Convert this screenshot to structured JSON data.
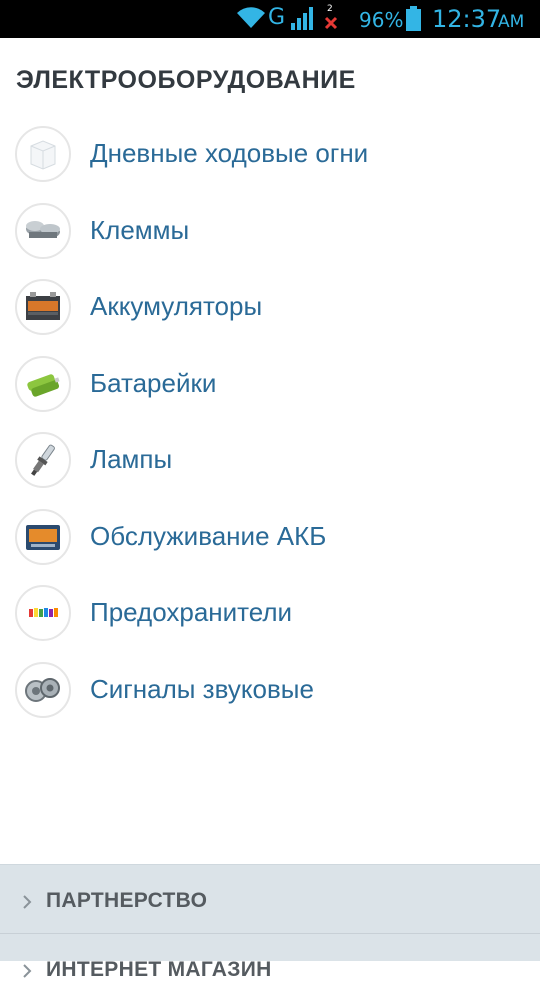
{
  "status_bar": {
    "network_type": "G",
    "sim_slot": "2",
    "battery_percent": "96%",
    "battery_level": 0.96,
    "time": "12:37",
    "ampm": "AM",
    "accent_color": "#33b5e5"
  },
  "section": {
    "title": "ЭЛЕКТРООБОРУДОВАНИЕ"
  },
  "categories": [
    {
      "label": "Дневные ходовые огни",
      "icon": "box-icon"
    },
    {
      "label": "Клеммы",
      "icon": "terminals-icon"
    },
    {
      "label": "Аккумуляторы",
      "icon": "car-battery-icon"
    },
    {
      "label": "Батарейки",
      "icon": "batteries-icon"
    },
    {
      "label": "Лампы",
      "icon": "bulb-icon"
    },
    {
      "label": "Обслуживание АКБ",
      "icon": "battery-charger-icon"
    },
    {
      "label": "Предохранители",
      "icon": "fuses-icon"
    },
    {
      "label": "Сигналы звуковые",
      "icon": "horn-icon"
    }
  ],
  "bottom_menu": {
    "items": [
      {
        "label": "ПАРТНЕРСТВО"
      },
      {
        "label": "ИНТЕРНЕТ МАГАЗИН"
      }
    ]
  },
  "colors": {
    "link": "#2a6a97",
    "title": "#333a40",
    "panel_bg": "#dbe3e8"
  }
}
